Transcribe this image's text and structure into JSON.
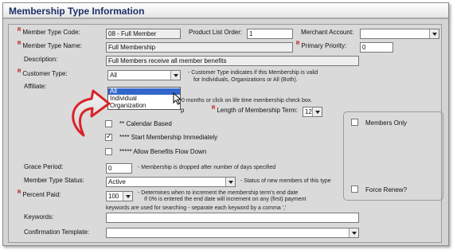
{
  "page": {
    "title": "Membership Type Information"
  },
  "fields": {
    "code": {
      "label": "Member Type Code:",
      "value": "08 - Full Member"
    },
    "product_order": {
      "label": "Product List Order:",
      "value": "1"
    },
    "merchant": {
      "label": "Merchant Account:",
      "value": ""
    },
    "name": {
      "label": "Member Type Name:",
      "value": "Full Membership"
    },
    "priority": {
      "label": "Primary Priority:",
      "value": "0"
    },
    "description": {
      "label": "Description:",
      "value": "Full Members receive all member benefits"
    },
    "customer_type": {
      "label": "Customer Type:",
      "value": "All",
      "note": "- Customer Type indicates if this Membership is valid",
      "note2": "for Individuals, Organizations or All (Both)."
    },
    "affiliate": {
      "label": "Affiliate:"
    },
    "term_note_partial": "0 months or click on life time membership check box.",
    "term_label_partial": "p",
    "term_length": {
      "label": "Length of Membership Term:",
      "value": "12"
    },
    "calendar": {
      "label": "** Calendar Based",
      "checked": false
    },
    "start_immediately": {
      "label": "**** Start Membership Immediately",
      "checked": true
    },
    "benefits_flow": {
      "label": "***** Allow Benefits Flow Down",
      "checked": false
    },
    "members_only": {
      "label": "Members Only",
      "checked": false
    },
    "force_renew": {
      "label": "Force Renew?",
      "checked": false
    },
    "grace": {
      "label": "Grace Period:",
      "value": "0",
      "note": "- Membership is dropped after number of days specified"
    },
    "status": {
      "label": "Member Type Status:",
      "value": "Active",
      "note": "- Status of new members of this type"
    },
    "percent_paid": {
      "label": "Percent Paid:",
      "value": "100",
      "note": "- Determines when to increment the membership term's end date",
      "note2": "If 0% is entered the end date will increment on any (first) payment"
    },
    "keywords": {
      "label": "Keywords:",
      "note": "keywords are used for searching - separate each keyword by a comma ','",
      "value": ""
    },
    "confirmation": {
      "label": "Confirmation Template:",
      "value": ""
    }
  },
  "customer_type_options": [
    "All",
    "Individual",
    "Organization"
  ],
  "required_marker": "R",
  "colors": {
    "title": "#1c2f66",
    "required": "#c00000",
    "selection": "#3366cc",
    "arrow": "#d9232a"
  }
}
